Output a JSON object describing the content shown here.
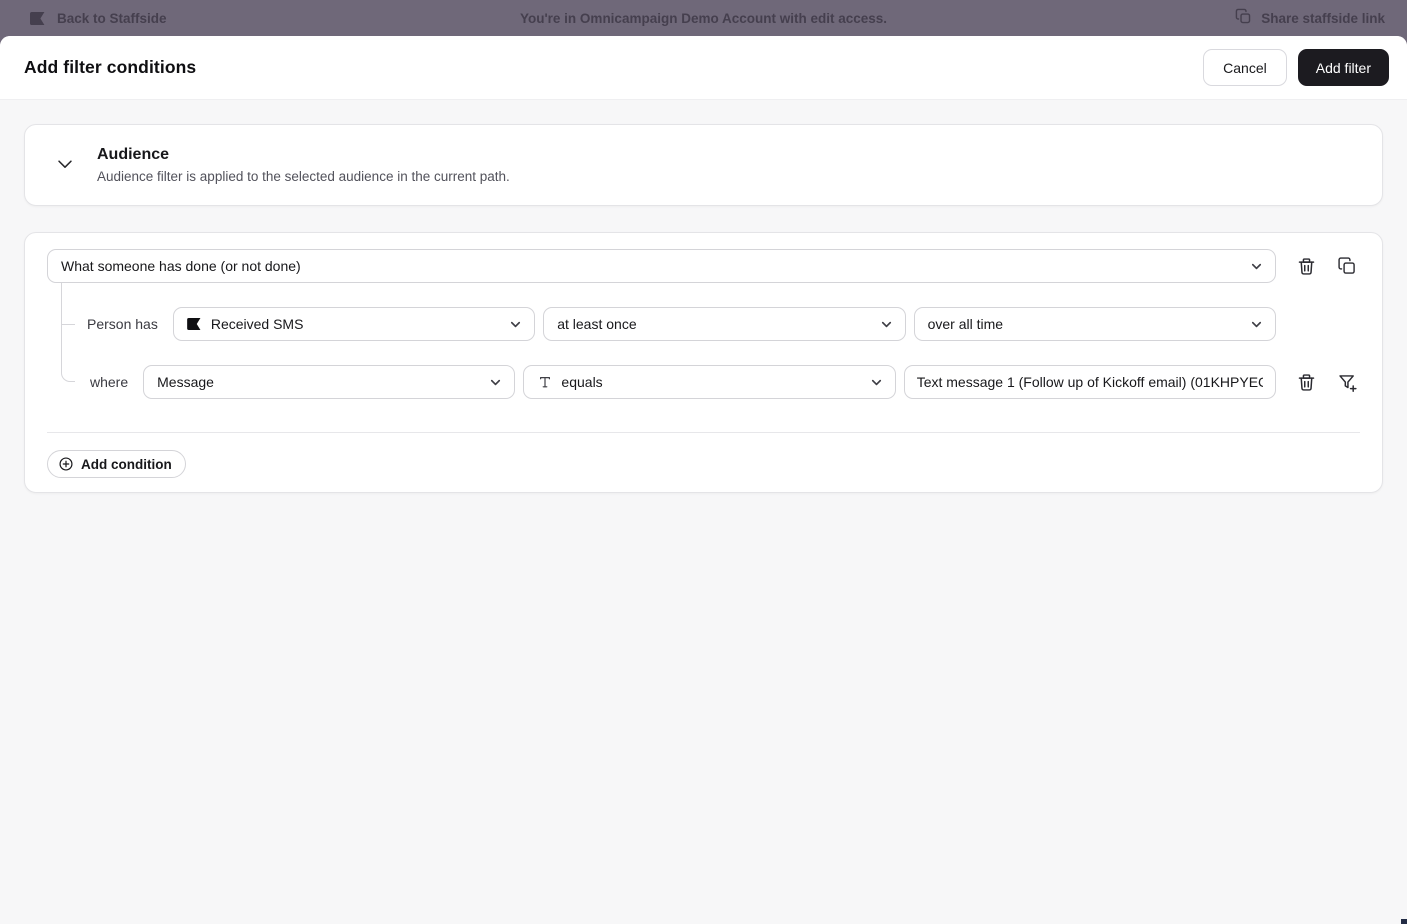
{
  "topbar": {
    "back_label": "Back to Staffside",
    "center_text": "You're in Omnicampaign Demo Account with edit access.",
    "share_label": "Share staffside link"
  },
  "modal": {
    "title": "Add filter conditions",
    "cancel_label": "Cancel",
    "add_filter_label": "Add filter"
  },
  "audience": {
    "title": "Audience",
    "description": "Audience filter is applied to the selected audience in the current path."
  },
  "condition": {
    "type_select_value": "What someone has done (or not done)",
    "person_has_label": "Person has",
    "event_select_value": "Received SMS",
    "frequency_select_value": "at least once",
    "timeframe_select_value": "over all time",
    "where_label": "where",
    "property_select_value": "Message",
    "operator_select_value": "equals",
    "value_input_value": "Text message 1 (Follow up of Kickoff email) (01KHPYEC",
    "add_condition_label": "Add condition"
  },
  "icons": {
    "brand": "flag-banner",
    "share": "copy-squares",
    "trash": "trash-can",
    "duplicate": "copy-squares",
    "chevron": "chevron-down",
    "operator_type": "text-T",
    "filter_add": "funnel-plus",
    "add": "plus-circle"
  },
  "colors": {
    "topbar-bg": "#6f6879",
    "topbar-text": "#453f4e",
    "page-bg": "#f7f7f8",
    "card-border": "#e4e4e7",
    "control-border": "#d4d4d8",
    "text-primary": "#18181b",
    "text-secondary": "#52525b",
    "primary-button-bg": "#1c1b20",
    "primary-button-text": "#ffffff"
  }
}
